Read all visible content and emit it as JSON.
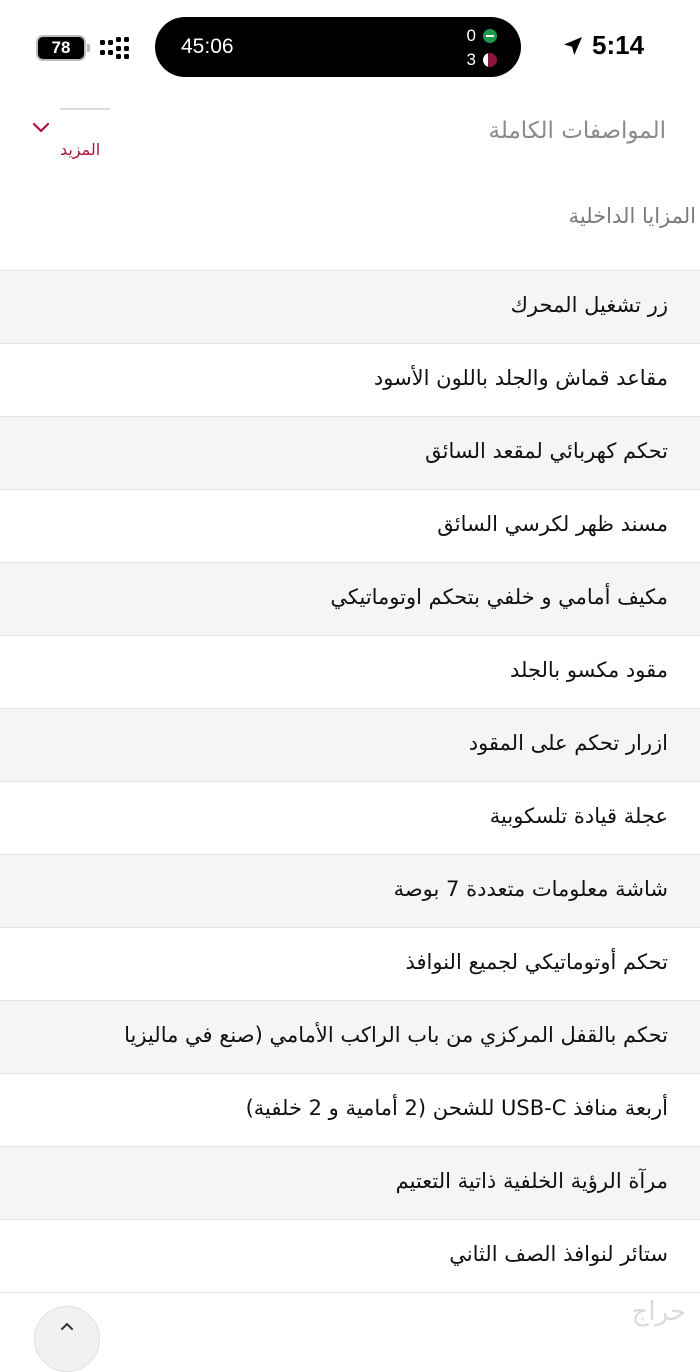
{
  "status_bar": {
    "time": "5:14",
    "battery": "78",
    "live_activity": {
      "timer": "45:06",
      "team1_score": "0",
      "team2_score": "3"
    }
  },
  "header": {
    "title": "المواصفات الكاملة",
    "more_label": "المزيد"
  },
  "section": {
    "title": "المزايا الداخلية"
  },
  "features": [
    "زر تشغيل المحرك",
    "مقاعد قماش والجلد باللون الأسود",
    "تحكم كهربائي لمقعد السائق",
    "مسند ظهر لكرسي السائق",
    "مكيف أمامي و خلفي بتحكم اوتوماتيكي",
    "مقود مكسو بالجلد",
    "ازرار تحكم على المقود",
    "عجلة قيادة تلسكوبية",
    "شاشة معلومات متعددة 7 بوصة",
    "تحكم أوتوماتيكي لجميع النوافذ",
    "تحكم بالقفل المركزي من باب الراكب الأمامي (صنع في ماليزيا",
    "أربعة منافذ USB-C للشحن (2 أمامية و 2 خلفية)",
    "مرآة الرؤية الخلفية ذاتية التعتيم",
    "ستائر لنوافذ الصف الثاني"
  ],
  "watermark": "حراج",
  "colors": {
    "accent": "#b0133a",
    "alt_row": "#f5f5f5",
    "title_gray": "#8a8a8a"
  },
  "icons": {
    "location": "location-arrow-icon",
    "chevron": "chevron-down-icon",
    "scroll_top": "chevron-up-icon",
    "signal": "signal-icon",
    "battery": "battery-icon"
  }
}
